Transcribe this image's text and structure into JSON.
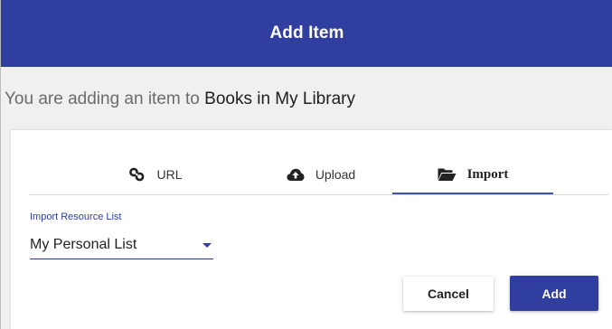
{
  "dialog": {
    "title": "Add Item",
    "subtitle_prefix": "You are adding an item to ",
    "subtitle_target": "Books in My Library"
  },
  "tabs": [
    {
      "label": "URL",
      "icon": "link-icon",
      "active": false
    },
    {
      "label": "Upload",
      "icon": "cloud-upload-icon",
      "active": false
    },
    {
      "label": "Import",
      "icon": "folder-open-icon",
      "active": true
    }
  ],
  "import_form": {
    "field_label": "Import Resource List",
    "selected_value": "My Personal List"
  },
  "actions": {
    "cancel_label": "Cancel",
    "add_label": "Add"
  },
  "colors": {
    "primary": "#303f9f",
    "background": "#f0f0f0"
  }
}
